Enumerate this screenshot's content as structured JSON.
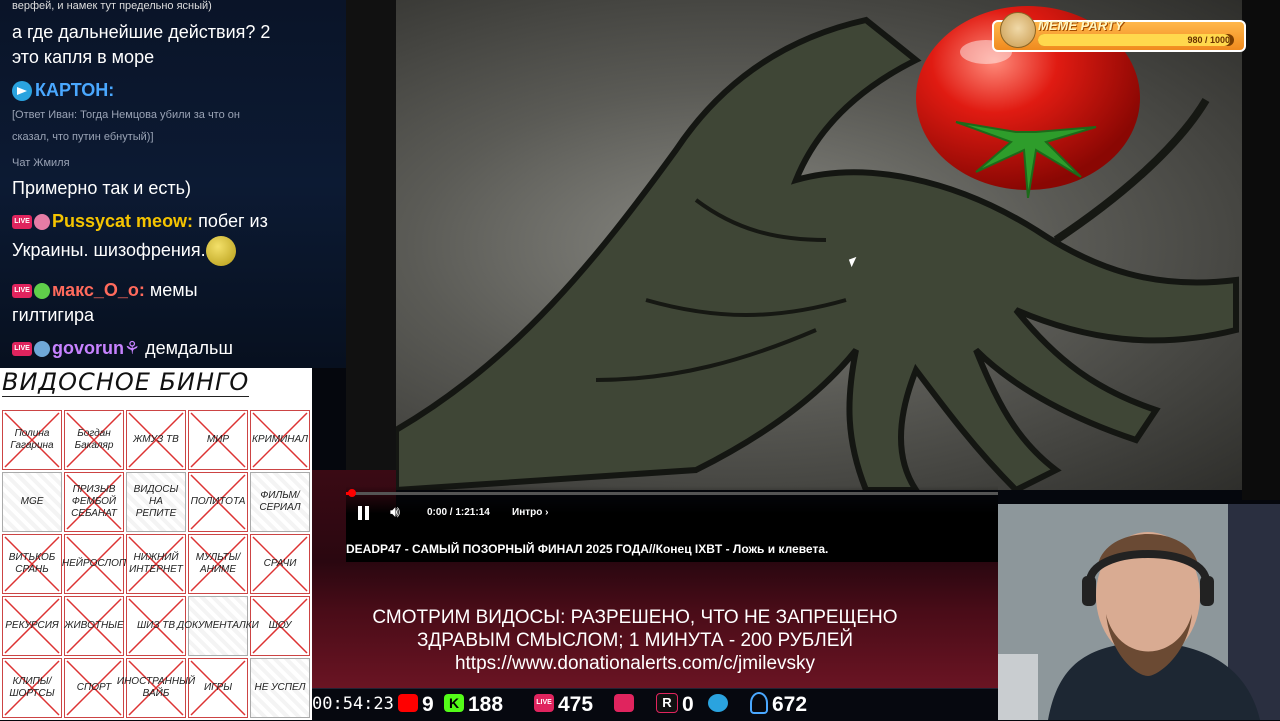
{
  "chat": {
    "lines": [
      "верфей, и намек тут предельно ясный)",
      "а где дальнейшие действия? 2",
      "это капля в море",
      "КАРТОН:",
      "[Ответ Иван: Тогда Немцова убили за что он",
      "сказал, что путин ебнутый)]",
      "Чат Жмиля",
      "Примерно так и есть)",
      "Pussycat meow:",
      "побег из",
      "Украины. шизофрения.",
      "макс_О_о:",
      "мемы",
      "гилтигира",
      "govorun",
      "демдальш"
    ],
    "live_label": "LIVE"
  },
  "bingo": {
    "title": "ВИДОСНОЕ БИНГО",
    "cells": [
      {
        "label": "Полина Гагарина",
        "crossed": true
      },
      {
        "label": "Богдан Бакаляр",
        "crossed": true
      },
      {
        "label": "ЖМУЗ ТВ",
        "crossed": true
      },
      {
        "label": "МИР",
        "crossed": true
      },
      {
        "label": "КРИМИНАЛ",
        "crossed": true
      },
      {
        "label": "MGE",
        "crossed": false
      },
      {
        "label": "ПРИЗЫВ ФЕМБОЙ СЕБАНАТ",
        "crossed": true
      },
      {
        "label": "ВИДОСЫ НА РЕПИТЕ",
        "crossed": false
      },
      {
        "label": "ПОЛИТОТА",
        "crossed": true
      },
      {
        "label": "ФИЛЬМ/ СЕРИАЛ",
        "crossed": false
      },
      {
        "label": "ВИТЬКОБ СРАНЬ",
        "crossed": true
      },
      {
        "label": "НЕЙРОСЛОП",
        "crossed": true
      },
      {
        "label": "НИЖНИЙ ИНТЕРНЕТ",
        "crossed": true
      },
      {
        "label": "МУЛЬТЫ/ АНИМЕ",
        "crossed": true
      },
      {
        "label": "СРАЧИ",
        "crossed": true
      },
      {
        "label": "РЕКУРСИЯ",
        "crossed": true
      },
      {
        "label": "ЖИВОТНЫЕ",
        "crossed": true
      },
      {
        "label": "ШИЗ ТВ",
        "crossed": true
      },
      {
        "label": "ДОКУМЕНТАЛКИ",
        "crossed": false
      },
      {
        "label": "ШОУ",
        "crossed": true
      },
      {
        "label": "КЛИПЫ/ ШОРТСЫ",
        "crossed": true
      },
      {
        "label": "СПОРТ",
        "crossed": true
      },
      {
        "label": "ИНОСТРАННЫЙ ВАЙБ",
        "crossed": true
      },
      {
        "label": "ИГРЫ",
        "crossed": true
      },
      {
        "label": "НЕ УСПЕЛ",
        "crossed": false
      }
    ]
  },
  "meme_party": {
    "title": "MEME PARTY",
    "value": "980 / 1000",
    "progress": 0.98
  },
  "player": {
    "time": "0:00 / 1:21:14",
    "chapter": "Интро",
    "chapter_arrow": "›",
    "video_title": "DEADP47 - САМЫЙ ПОЗОРНЫЙ ФИНАЛ 2025 ГОДА//Конец IXBT - Ложь и клевета.",
    "played_fraction": 0.005
  },
  "banner": {
    "line1": "СМОТРИМ ВИДОСЫ: РАЗРЕШЕНО, ЧТО НЕ ЗАПРЕЩЕНО",
    "line2": "ЗДРАВЫМ СМЫСЛОМ; 1 МИНУТА - 200 РУБЛЕЙ",
    "line3": "https://www.donationalerts.com/c/jmilevsky"
  },
  "stats": {
    "uptime": "00:54:23",
    "youtube": "9",
    "kick": "188",
    "live": "475",
    "rutube": "",
    "r": "0",
    "telegram": "",
    "viewers": "672",
    "kick_letter": "K",
    "live_letter": "LIVE",
    "r_letter": "R"
  },
  "colors": {
    "youtube": "#ff0000",
    "kick": "#53fc18",
    "live": "#e0245e",
    "telegram": "#2aa3df",
    "chat_nick_kartoh": "#4aa8ff",
    "chat_nick_pussycat": "#f5c400",
    "chat_nick_maks": "#ff6a5c",
    "chat_nick_govorun": "#c782ff"
  }
}
